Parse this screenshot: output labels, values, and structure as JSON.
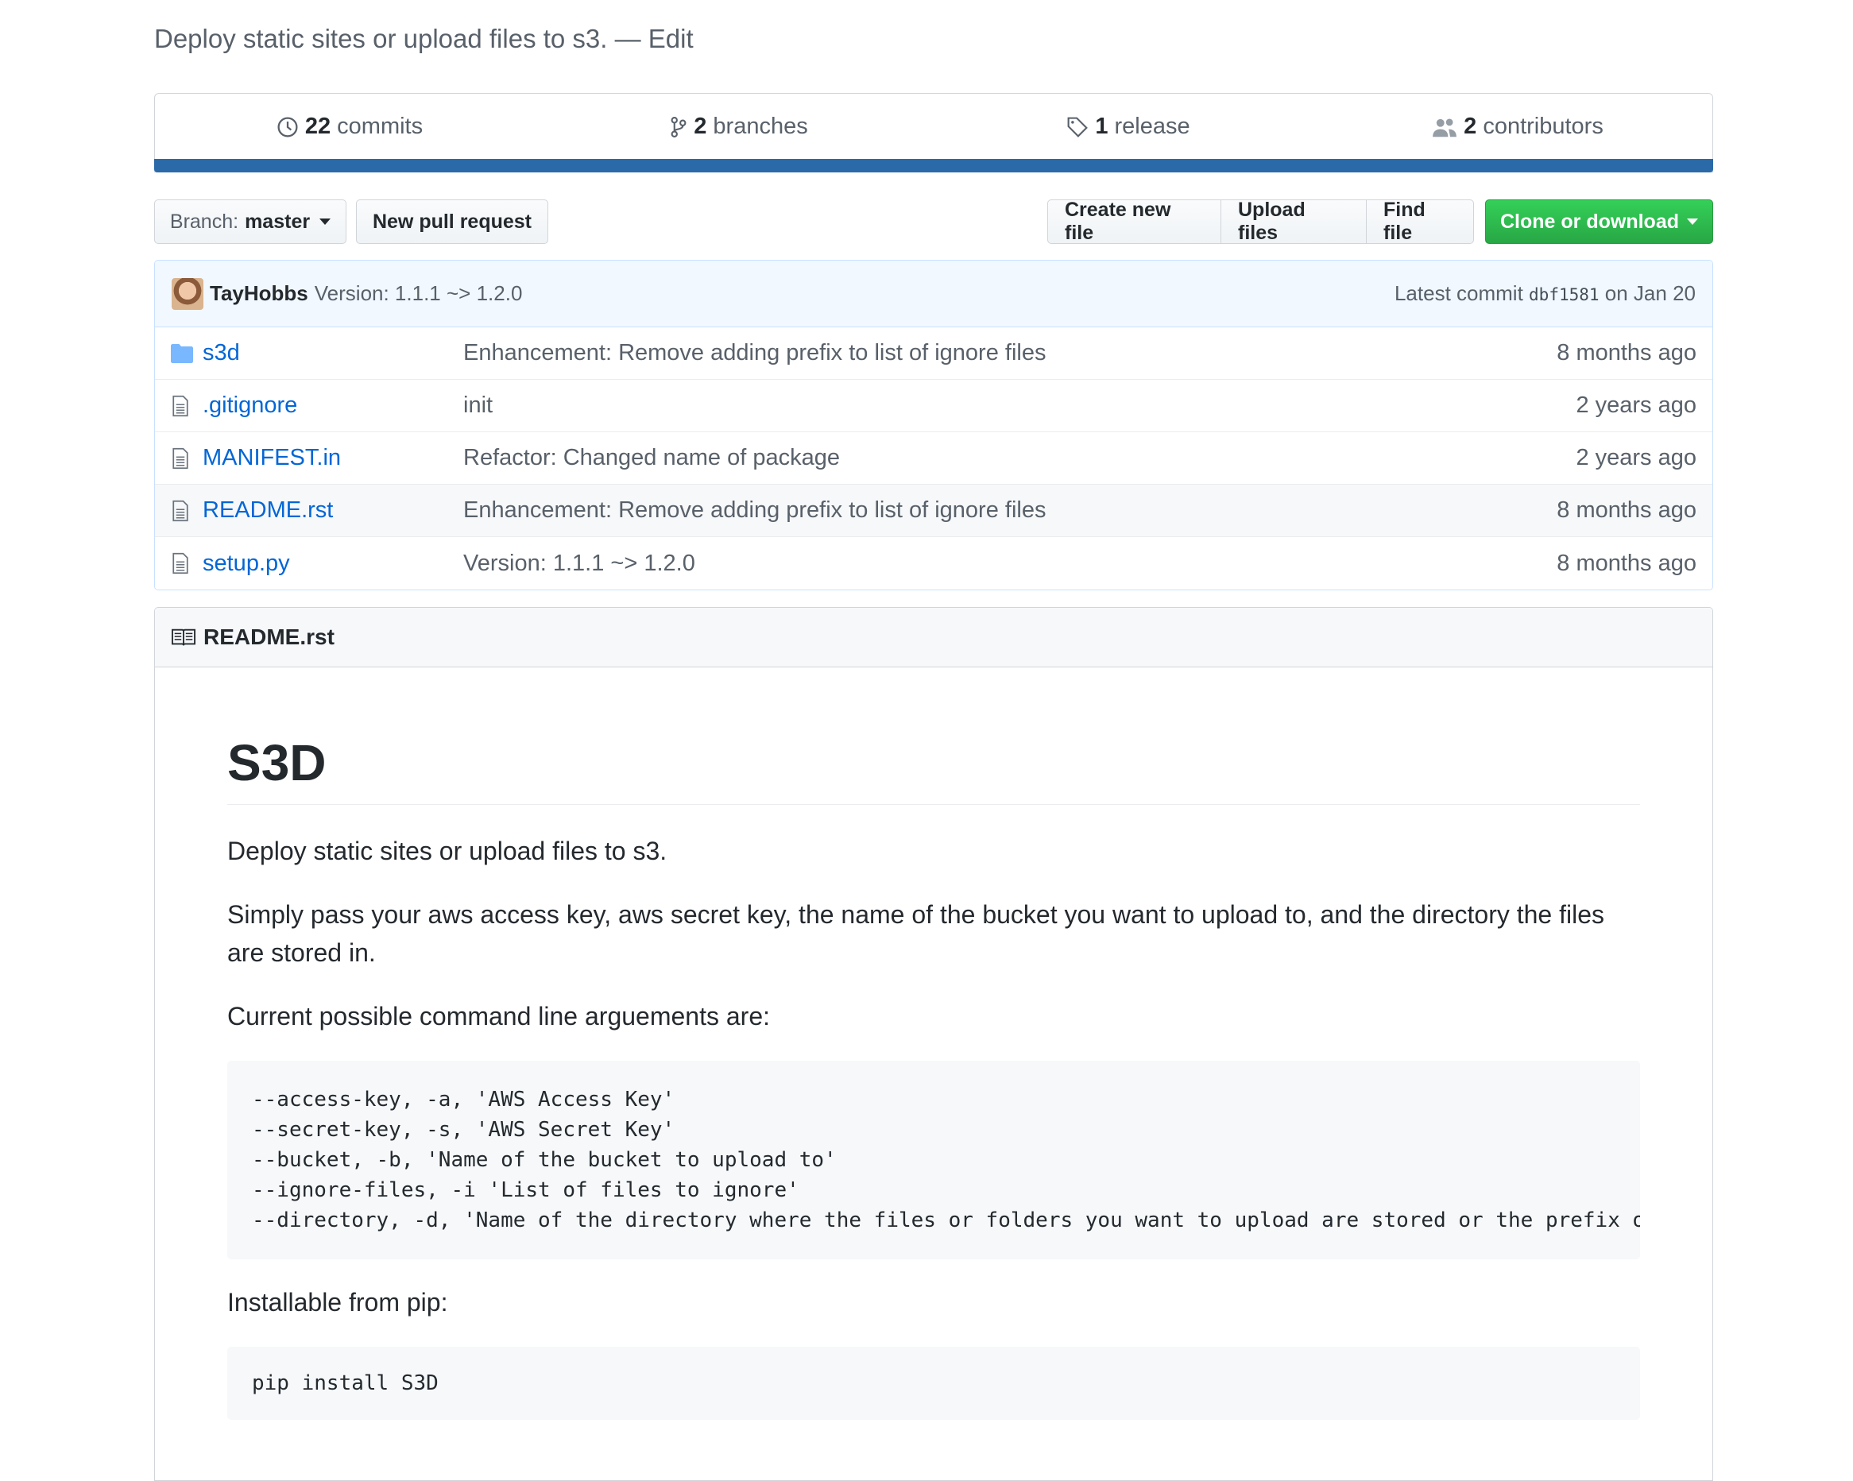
{
  "repo": {
    "description": "Deploy static sites or upload files to s3.",
    "edit_label": "Edit"
  },
  "summary": {
    "commits": {
      "count": "22",
      "label": "commits",
      "icon": "history-icon"
    },
    "branches": {
      "count": "2",
      "label": "branches",
      "icon": "branch-icon"
    },
    "releases": {
      "count": "1",
      "label": "release",
      "icon": "tag-icon"
    },
    "contributors": {
      "count": "2",
      "label": "contributors",
      "icon": "people-icon"
    },
    "bar_color": "#2b6aa8"
  },
  "toolbar": {
    "branch_prefix": "Branch:",
    "branch_name": "master",
    "new_pull_request": "New pull request",
    "create_new_file": "Create new file",
    "upload_files": "Upload files",
    "find_file": "Find file",
    "clone_or_download": "Clone or download"
  },
  "latest_commit": {
    "author": "TayHobbs",
    "message": "Version: 1.1.1 ~> 1.2.0",
    "prefix": "Latest commit",
    "sha": "dbf1581",
    "date": "on Jan 20"
  },
  "files": [
    {
      "name": "s3d",
      "type": "folder",
      "message": "Enhancement: Remove adding prefix to list of ignore files",
      "age": "8 months ago"
    },
    {
      "name": ".gitignore",
      "type": "file",
      "message": "init",
      "age": "2 years ago"
    },
    {
      "name": "MANIFEST.in",
      "type": "file",
      "message": "Refactor: Changed name of package",
      "age": "2 years ago"
    },
    {
      "name": "README.rst",
      "type": "file",
      "message": "Enhancement: Remove adding prefix to list of ignore files",
      "age": "8 months ago"
    },
    {
      "name": "setup.py",
      "type": "file",
      "message": "Version: 1.1.1 ~> 1.2.0",
      "age": "8 months ago"
    }
  ],
  "readme": {
    "filename": "README.rst",
    "title": "S3D",
    "paragraph1": "Deploy static sites or upload files to s3.",
    "paragraph2": "Simply pass your aws access key, aws secret key, the name of the bucket you want to upload to, and the directory the files are stored in.",
    "paragraph3": "Current possible command line arguements are:",
    "code1": "--access-key, -a, 'AWS Access Key'\n--secret-key, -s, 'AWS Secret Key'\n--bucket, -b, 'Name of the bucket to upload to'\n--ignore-files, -i 'List of files to ignore'\n--directory, -d, 'Name of the directory where the files or folders you want to upload are stored or the prefix of the",
    "paragraph4": "Installable from pip:",
    "code2": "pip install S3D"
  },
  "colors": {
    "link": "#0366d6",
    "green_button": "#28a745",
    "commit_bg": "#f1f8ff"
  }
}
